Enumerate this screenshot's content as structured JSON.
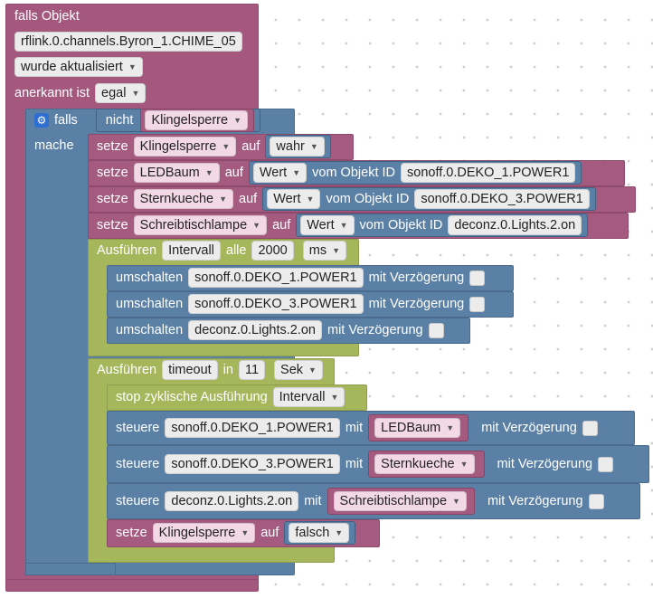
{
  "trigger": {
    "label_if_object": "falls Objekt",
    "object_id": "rflink.0.channels.Byron_1.CHIME_05",
    "update_mode": "wurde aktualisiert",
    "ack_label": "anerkannt ist",
    "ack_value": "egal"
  },
  "if_block": {
    "if_label": "falls",
    "not_label": "nicht",
    "condition_var": "Klingelsperre",
    "do_label": "mache"
  },
  "set_rows": [
    {
      "set_label": "setze",
      "var": "Klingelsperre",
      "to_label": "auf",
      "value": "wahr"
    },
    {
      "set_label": "setze",
      "var": "LEDBaum",
      "to_label": "auf",
      "value": "Wert",
      "from_label": "vom Objekt ID",
      "object_id": "sonoff.0.DEKO_1.POWER1"
    },
    {
      "set_label": "setze",
      "var": "Sternkueche",
      "to_label": "auf",
      "value": "Wert",
      "from_label": "vom Objekt ID",
      "object_id": "sonoff.0.DEKO_3.POWER1"
    },
    {
      "set_label": "setze",
      "var": "Schreibtischlampe",
      "to_label": "auf",
      "value": "Wert",
      "from_label": "vom Objekt ID",
      "object_id": "deconz.0.Lights.2.on"
    }
  ],
  "interval_block": {
    "exec_label": "Ausführen",
    "name": "Intervall",
    "every_label": "alle",
    "amount": "2000",
    "unit": "ms",
    "toggles": [
      {
        "label": "umschalten",
        "object_id": "sonoff.0.DEKO_1.POWER1",
        "delay_label": "mit Verzögerung"
      },
      {
        "label": "umschalten",
        "object_id": "sonoff.0.DEKO_3.POWER1",
        "delay_label": "mit Verzögerung"
      },
      {
        "label": "umschalten",
        "object_id": "deconz.0.Lights.2.on",
        "delay_label": "mit Verzögerung"
      }
    ]
  },
  "timeout_block": {
    "exec_label": "Ausführen",
    "name": "timeout",
    "in_label": "in",
    "amount": "11",
    "unit": "Sek",
    "stop_label": "stop zyklische Ausführung",
    "stop_target": "Intervall",
    "controls": [
      {
        "label": "steuere",
        "object_id": "sonoff.0.DEKO_1.POWER1",
        "with_label": "mit",
        "var": "LEDBaum",
        "delay_label": "mit Verzögerung"
      },
      {
        "label": "steuere",
        "object_id": "sonoff.0.DEKO_3.POWER1",
        "with_label": "mit",
        "var": "Sternkueche",
        "delay_label": "mit Verzögerung"
      },
      {
        "label": "steuere",
        "object_id": "deconz.0.Lights.2.on",
        "with_label": "mit",
        "var": "Schreibtischlampe",
        "delay_label": "mit Verzögerung"
      }
    ],
    "final_set": {
      "set_label": "setze",
      "var": "Klingelsperre",
      "to_label": "auf",
      "value": "falsch"
    }
  },
  "colors": {
    "trigger": "#a5587e",
    "control": "#5b80a5",
    "timer": "#a5b65b",
    "variable": "#a55b80"
  }
}
